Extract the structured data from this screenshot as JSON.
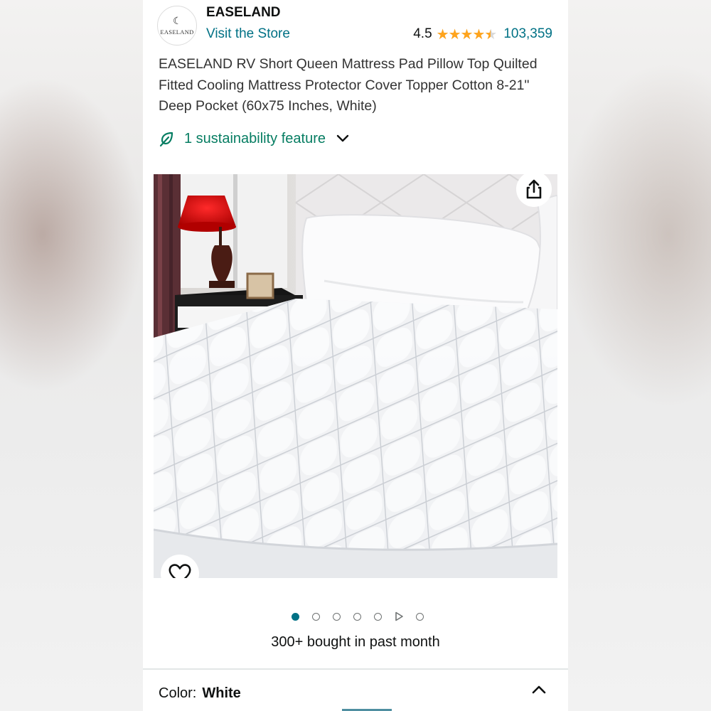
{
  "store": {
    "logo_text": "EASELAND",
    "brand": "EASELAND",
    "visit_label": "Visit the Store"
  },
  "rating": {
    "value": "4.5",
    "stars_fraction": 0.9,
    "review_count": "103,359"
  },
  "product": {
    "title": "EASELAND RV Short Queen Mattress Pad Pillow Top Quilted Fitted Cooling Mattress Protector Cover Topper Cotton 8-21\" Deep Pocket (60x75 Inches, White)"
  },
  "sustainability": {
    "label": "1 sustainability feature",
    "icon": "leaf-icon"
  },
  "gallery": {
    "image_count": 7,
    "active_index": 0,
    "video_index": 5,
    "share_icon": "share-icon",
    "wishlist_icon": "heart-icon"
  },
  "social_proof": {
    "bought": "300+ bought in past month"
  },
  "variation": {
    "label": "Color:",
    "value": "White"
  },
  "colors": {
    "link": "#007185",
    "star": "#ffa41c",
    "sustain": "#067d62"
  }
}
